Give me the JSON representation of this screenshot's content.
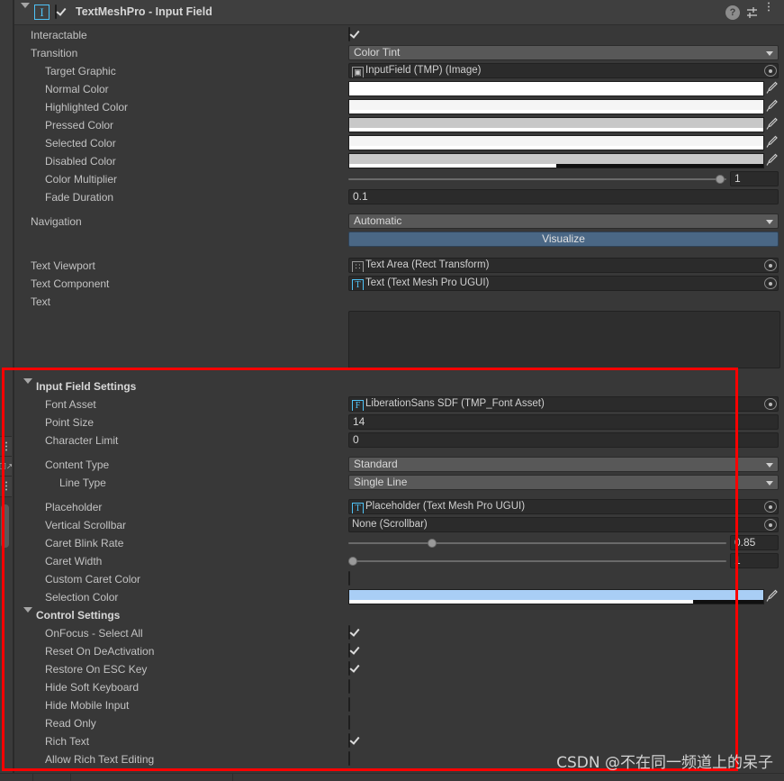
{
  "header": {
    "title": "TextMeshPro - Input Field",
    "component_icon": "I",
    "enabled": true,
    "expanded": true,
    "icons": [
      {
        "name": "help-icon",
        "glyph": "?"
      },
      {
        "name": "preset-icon",
        "glyph": "preset"
      },
      {
        "name": "more-menu-icon",
        "glyph": "kebab"
      }
    ]
  },
  "accent": {
    "blue": "#4fc3f7",
    "visualize_button": "#4a6785",
    "selection_color": "#a9cef5",
    "annotation_red": "#fe0000"
  },
  "rows": [
    {
      "label": "Interactable",
      "indent": 1,
      "type": "checkbox",
      "value": true
    },
    {
      "label": "Transition",
      "indent": 1,
      "type": "popup",
      "value": "Color Tint"
    },
    {
      "label": "Target Graphic",
      "indent": 2,
      "type": "object",
      "value": "InputField (TMP) (Image)",
      "badge": "img",
      "badge_plain": true
    },
    {
      "label": "Normal Color",
      "indent": 2,
      "type": "color",
      "color": "#ffffff",
      "alpha": 100
    },
    {
      "label": "Highlighted Color",
      "indent": 2,
      "type": "color",
      "color": "#f5f5f5",
      "alpha": 100
    },
    {
      "label": "Pressed Color",
      "indent": 2,
      "type": "color",
      "color": "#c8c8c8",
      "alpha": 100
    },
    {
      "label": "Selected Color",
      "indent": 2,
      "type": "color",
      "color": "#f5f5f5",
      "alpha": 100
    },
    {
      "label": "Disabled Color",
      "indent": 2,
      "type": "color",
      "color": "#c8c8c8",
      "alpha": 50
    },
    {
      "label": "Color Multiplier",
      "indent": 2,
      "type": "slider",
      "value": "1",
      "fill": 1
    },
    {
      "label": "Fade Duration",
      "indent": 2,
      "type": "number",
      "value": "0.1"
    },
    {
      "label": "Navigation",
      "indent": 1,
      "type": "popup",
      "value": "Automatic"
    },
    {
      "label": "",
      "indent": 1,
      "type": "button",
      "value": "Visualize"
    },
    {
      "label": "Text Viewport",
      "indent": 1,
      "type": "object",
      "value": "Text Area (Rect Transform)",
      "badge": "rect",
      "badge_plain": true
    },
    {
      "label": "Text Component",
      "indent": 1,
      "type": "object",
      "value": "Text (Text Mesh Pro UGUI)",
      "badge": "T",
      "badge_plain": false
    },
    {
      "label": "Text",
      "indent": 1,
      "type": "textarea",
      "value": ""
    }
  ],
  "sections": [
    {
      "title": "Input Field Settings",
      "expanded": true,
      "rows": [
        {
          "label": "Font Asset",
          "indent": 2,
          "type": "object",
          "value": "LiberationSans SDF (TMP_Font Asset)",
          "badge": "F",
          "badge_plain": false
        },
        {
          "label": "Point Size",
          "indent": 2,
          "type": "number",
          "value": "14"
        },
        {
          "label": "Character Limit",
          "indent": 2,
          "type": "number",
          "value": "0"
        },
        {
          "label": "Content Type",
          "indent": 2,
          "type": "popup",
          "value": "Standard"
        },
        {
          "label": "Line Type",
          "indent": 3,
          "type": "popup",
          "value": "Single Line"
        },
        {
          "label": "Placeholder",
          "indent": 2,
          "type": "object",
          "value": "Placeholder (Text Mesh Pro UGUI)",
          "badge": "T",
          "badge_plain": false
        },
        {
          "label": "Vertical Scrollbar",
          "indent": 2,
          "type": "object",
          "value": "None (Scrollbar)",
          "badge": "",
          "badge_plain": false
        },
        {
          "label": "Caret Blink Rate",
          "indent": 2,
          "type": "slider",
          "value": "0.85",
          "fill": 0.215
        },
        {
          "label": "Caret Width",
          "indent": 2,
          "type": "slider",
          "value": "1",
          "fill": 0
        },
        {
          "label": "Custom Caret Color",
          "indent": 2,
          "type": "checkbox",
          "value": false
        },
        {
          "label": "Selection Color",
          "indent": 2,
          "type": "color",
          "color": "#a9cef5",
          "alpha": 83
        }
      ]
    },
    {
      "title": "Control Settings",
      "expanded": true,
      "rows": [
        {
          "label": "OnFocus - Select All",
          "indent": 2,
          "type": "checkbox",
          "value": true
        },
        {
          "label": "Reset On DeActivation",
          "indent": 2,
          "type": "checkbox",
          "value": true
        },
        {
          "label": "Restore On ESC Key",
          "indent": 2,
          "type": "checkbox",
          "value": true
        },
        {
          "label": "Hide Soft Keyboard",
          "indent": 2,
          "type": "checkbox",
          "value": false
        },
        {
          "label": "Hide Mobile Input",
          "indent": 2,
          "type": "checkbox",
          "value": false
        },
        {
          "label": "Read Only",
          "indent": 2,
          "type": "checkbox",
          "value": false
        },
        {
          "label": "Rich Text",
          "indent": 2,
          "type": "checkbox",
          "value": true
        },
        {
          "label": "Allow Rich Text Editing",
          "indent": 2,
          "type": "checkbox",
          "value": false
        }
      ]
    }
  ],
  "toolstrip": [
    {
      "name": "kebab-icon"
    },
    {
      "name": "popout-icon"
    },
    {
      "name": "kebab-icon-2"
    }
  ],
  "watermark": "CSDN @不在同一频道上的呆子"
}
